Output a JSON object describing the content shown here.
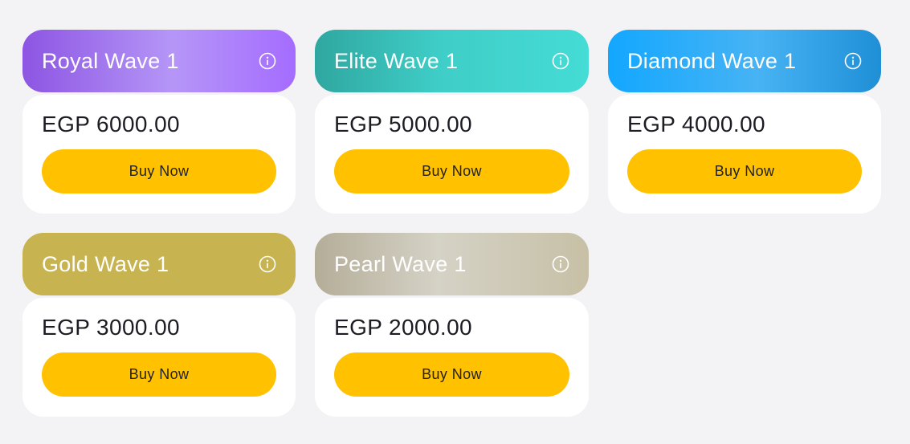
{
  "packages": [
    {
      "title": "Royal Wave 1",
      "price": "EGP 6000.00",
      "button_label": "Buy Now"
    },
    {
      "title": "Elite Wave 1",
      "price": "EGP 5000.00",
      "button_label": "Buy Now"
    },
    {
      "title": "Diamond Wave 1",
      "price": "EGP 4000.00",
      "button_label": "Buy Now"
    },
    {
      "title": "Gold Wave 1",
      "price": "EGP 3000.00",
      "button_label": "Buy Now"
    },
    {
      "title": "Pearl Wave 1",
      "price": "EGP 2000.00",
      "button_label": "Buy Now"
    }
  ],
  "colors": {
    "button": "#ffc100",
    "background": "#f3f3f5",
    "royal": "#a56cff",
    "elite": "#3fcdc7",
    "diamond": "#13a7ff",
    "gold": "#c7b350",
    "pearl": "#d5d2c6"
  },
  "icons": {
    "header_info": "info-icon"
  }
}
